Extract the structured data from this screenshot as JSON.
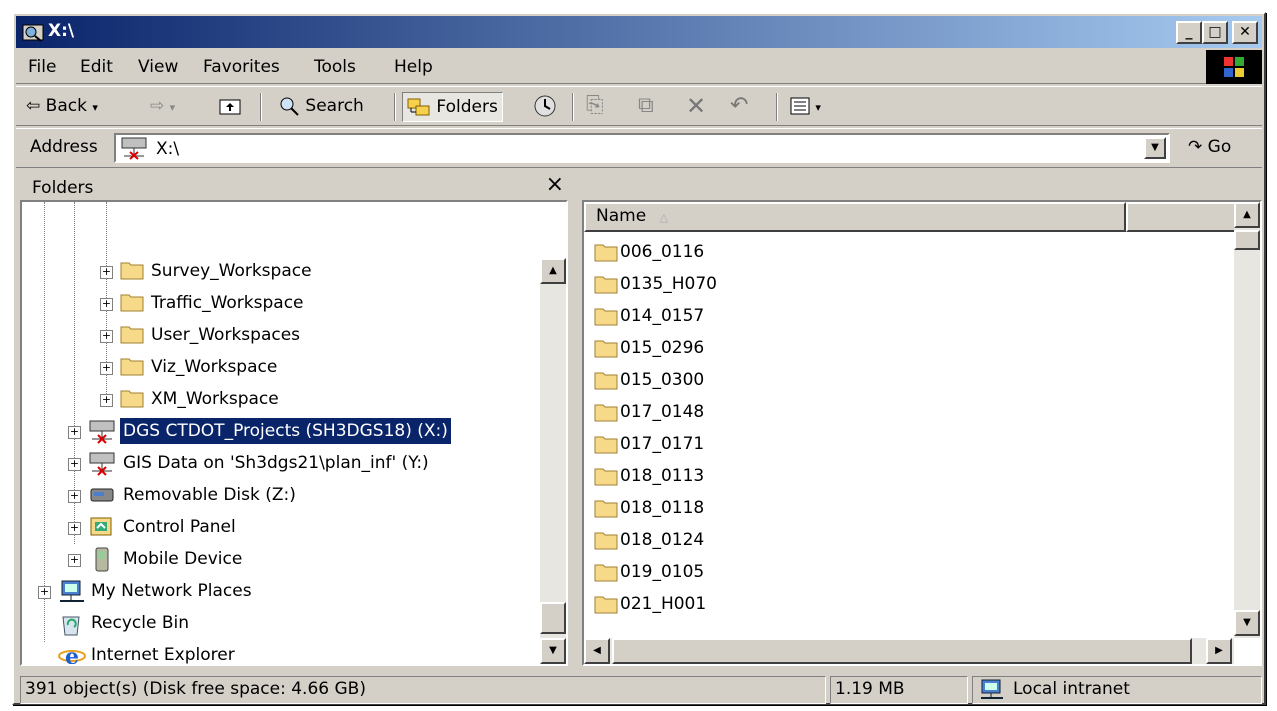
{
  "window": {
    "title": "X:\\"
  },
  "caption_buttons": {
    "minimize": "_",
    "maximize": "□",
    "close": "✕"
  },
  "menu": [
    "File",
    "Edit",
    "View",
    "Favorites",
    "Tools",
    "Help"
  ],
  "toolbar": {
    "back": "Back",
    "search": "Search",
    "folders": "Folders"
  },
  "address": {
    "label": "Address",
    "value": "X:\\",
    "go": "Go"
  },
  "folders_pane": {
    "title": "Folders",
    "close": "×",
    "items": [
      {
        "label": "Survey_Workspace"
      },
      {
        "label": "Traffic_Workspace"
      },
      {
        "label": "User_Workspaces"
      },
      {
        "label": "Viz_Workspace"
      },
      {
        "label": "XM_Workspace"
      },
      {
        "label": "DGS CTDOT_Projects (SH3DGS18) (X:)"
      },
      {
        "label": "GIS Data on 'Sh3dgs21\\plan_inf' (Y:)"
      },
      {
        "label": "Removable Disk (Z:)"
      },
      {
        "label": "Control Panel"
      },
      {
        "label": "Mobile Device"
      },
      {
        "label": "My Network Places"
      },
      {
        "label": "Recycle Bin"
      },
      {
        "label": "Internet Explorer"
      }
    ]
  },
  "list_pane": {
    "columns": [
      "Name"
    ],
    "items": [
      "006_0116",
      "0135_H070",
      "014_0157",
      "015_0296",
      "015_0300",
      "017_0148",
      "017_0171",
      "018_0113",
      "018_0118",
      "018_0124",
      "019_0105",
      "021_H001"
    ]
  },
  "status": {
    "objects": "391 object(s) (Disk free space: 4.66 GB)",
    "size": "1.19 MB",
    "zone": "Local intranet"
  },
  "icons": [
    "explorer-icon",
    "back-arrow-icon",
    "forward-arrow-icon",
    "up-folder-icon",
    "search-icon",
    "folders-icon",
    "history-icon",
    "move-to-icon",
    "copy-to-icon",
    "delete-icon",
    "undo-icon",
    "views-icon",
    "network-drive-icon",
    "go-arrow-icon",
    "folder-icon",
    "removable-disk-icon",
    "control-panel-icon",
    "mobile-device-icon",
    "network-places-icon",
    "recycle-bin-icon",
    "internet-explorer-icon",
    "local-intranet-icon",
    "windows-logo-icon"
  ]
}
